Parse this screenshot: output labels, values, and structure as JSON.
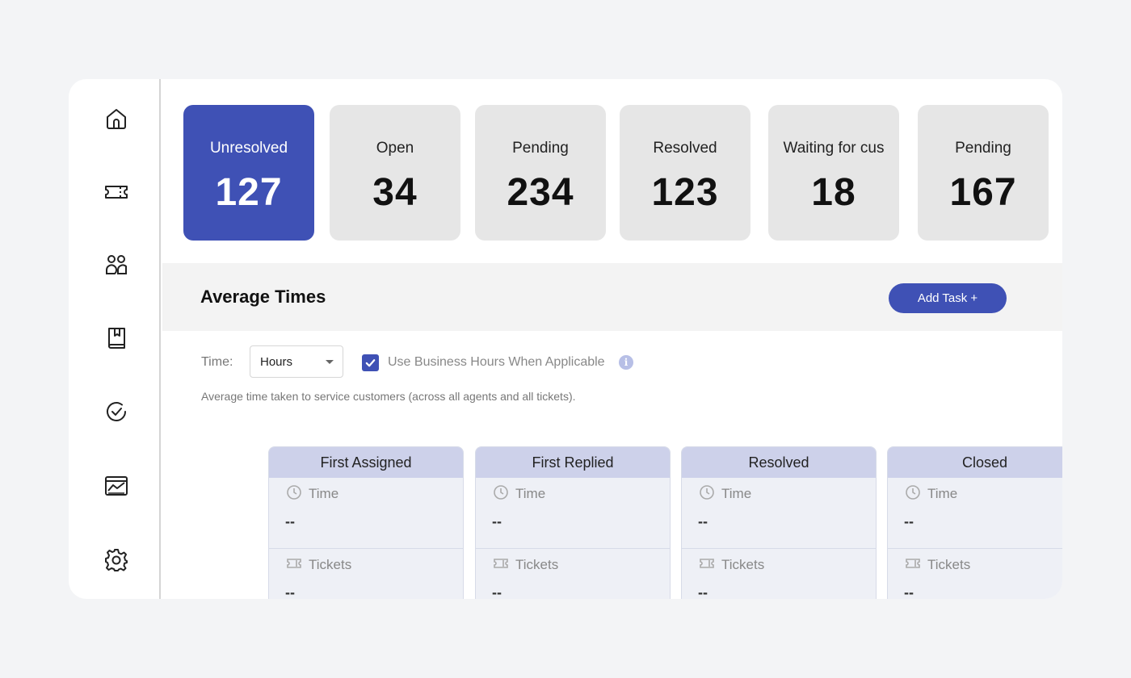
{
  "sidebar": {
    "items": [
      {
        "icon": "home-icon"
      },
      {
        "icon": "ticket-icon"
      },
      {
        "icon": "contacts-icon"
      },
      {
        "icon": "knowledge-base-icon"
      },
      {
        "icon": "task-check-icon"
      },
      {
        "icon": "analytics-icon"
      },
      {
        "icon": "settings-icon"
      }
    ]
  },
  "stats": [
    {
      "label": "Unresolved",
      "value": "127"
    },
    {
      "label": "Open",
      "value": "34"
    },
    {
      "label": "Pending",
      "value": "234"
    },
    {
      "label": "Resolved",
      "value": "123"
    },
    {
      "label": "Waiting for cus",
      "value": "18"
    },
    {
      "label": "Pending",
      "value": "167"
    }
  ],
  "average_times": {
    "title": "Average Times",
    "add_task_label": "Add Task +",
    "time_label": "Time:",
    "time_select_value": "Hours",
    "business_hours_checked": true,
    "business_hours_label": "Use Business Hours When Applicable",
    "info_glyph": "i",
    "description": "Average time taken to service customers (across all agents and all tickets).",
    "metrics": [
      {
        "title": "First Assigned",
        "time_label": "Time",
        "time_value": "--",
        "tickets_label": "Tickets",
        "tickets_value": "--"
      },
      {
        "title": "First Replied",
        "time_label": "Time",
        "time_value": "--",
        "tickets_label": "Tickets",
        "tickets_value": "--"
      },
      {
        "title": "Resolved",
        "time_label": "Time",
        "time_value": "--",
        "tickets_label": "Tickets",
        "tickets_value": "--"
      },
      {
        "title": "Closed",
        "time_label": "Time",
        "time_value": "--",
        "tickets_label": "Tickets",
        "tickets_value": "--"
      }
    ]
  },
  "colors": {
    "accent": "#3f51b5",
    "stat_inactive_bg": "#e6e6e6",
    "metric_header_bg": "#cdd1ea",
    "page_bg": "#f3f4f6"
  }
}
